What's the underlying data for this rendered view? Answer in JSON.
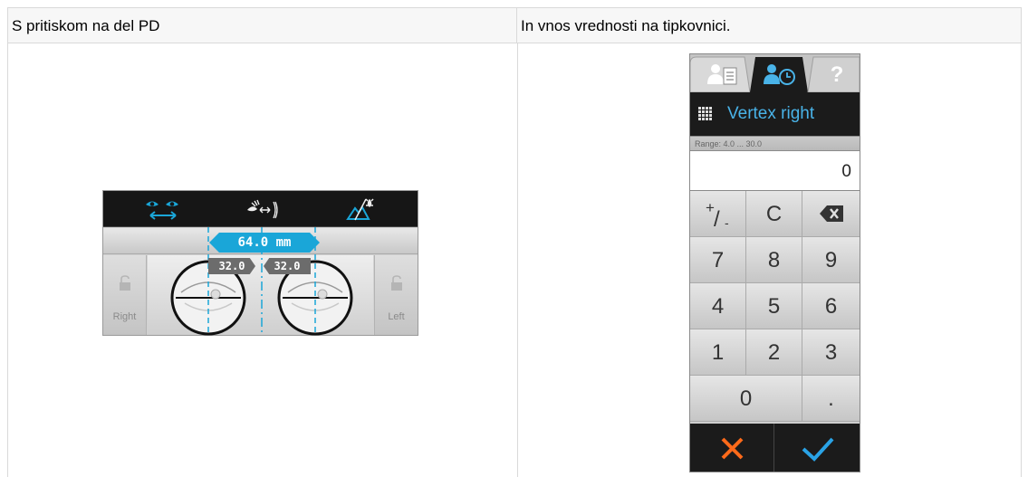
{
  "table": {
    "header_left": "S pritiskom na del PD",
    "header_right": "In vnos vrednosti na tipkovnici."
  },
  "pd_panel": {
    "total": "64.0 mm",
    "right_value": "32.0",
    "left_value": "32.0",
    "lock_right_label": "Right",
    "lock_left_label": "Left",
    "accent_color": "#1aa6d8"
  },
  "keypad": {
    "title": "Vertex right",
    "range": "Range: 4.0 ... 30.0",
    "display_value": "0",
    "keys": {
      "sign": "+/-",
      "clear": "C",
      "k7": "7",
      "k8": "8",
      "k9": "9",
      "k4": "4",
      "k5": "5",
      "k6": "6",
      "k1": "1",
      "k2": "2",
      "k3": "3",
      "k0": "0",
      "dot": "."
    },
    "cancel_color": "#ff6a1a",
    "ok_color": "#2aa3e6",
    "title_color": "#49b3e8"
  }
}
